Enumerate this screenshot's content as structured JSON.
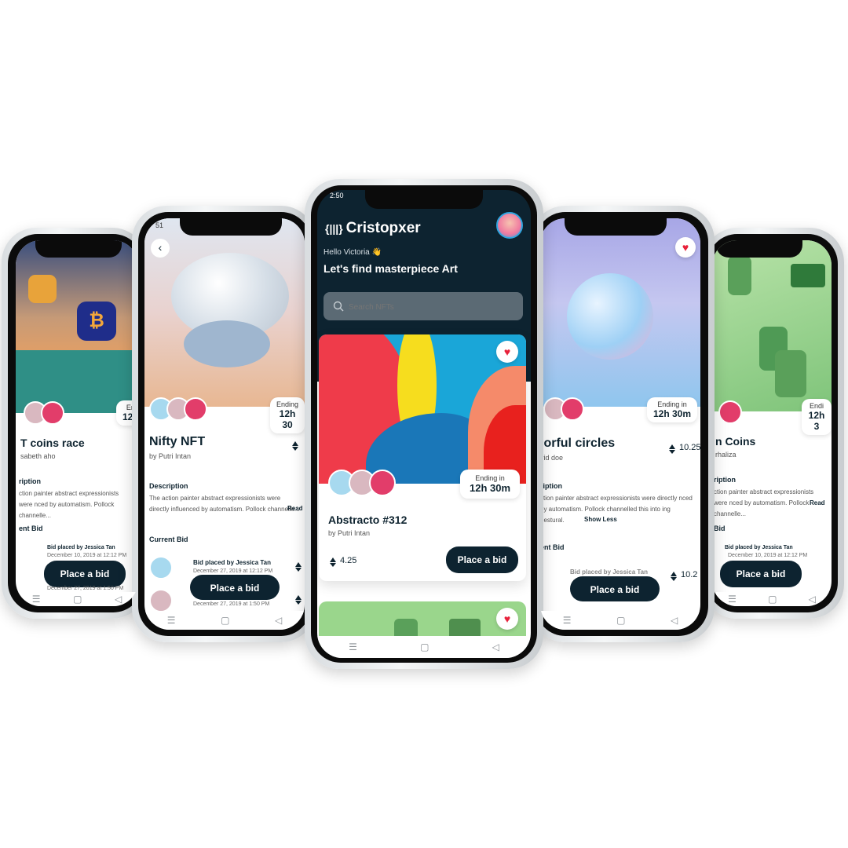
{
  "center": {
    "status_time": "2:50",
    "brand_icon": "{|||}",
    "brand_name": "Cristopxer",
    "greeting": "Hello Victoria 👋",
    "headline": "Let's find masterpiece Art",
    "search_placeholder": "Search NFTs",
    "card": {
      "ending_label": "Ending in",
      "ending_value": "12h 30m",
      "title": "Abstracto #312",
      "author": "by Putri Intan",
      "price": "4.25",
      "bid_label": "Place a bid"
    }
  },
  "left_near": {
    "status_time": "51",
    "ending_label": "Ending",
    "ending_value": "12h 30",
    "title": "Nifty NFT",
    "author": "by Putri Intan",
    "description_label": "Description",
    "description": "The action painter abstract expressionists were directly influenced by automatism. Pollock channelle...",
    "read_more": "Read",
    "current_bid_label": "Current Bid",
    "bid_by": "Bid placed by Jessica Tan",
    "bid_date_1": "December 27, 2019 at 12:12 PM",
    "bid_date_2": "December 27, 2019 at 1:50 PM",
    "bid_label": "Place a bid"
  },
  "left_far": {
    "ending_label": "En",
    "ending_value": "12h",
    "title": "T coins race",
    "author": "sabeth aho",
    "description_label": "ription",
    "description": "ction painter abstract expressionists were nced by automatism. Pollock channelle...",
    "current_bid_label": "ent Bid",
    "bid_by": "Bid placed by Jessica Tan",
    "bid_date_1": "December 10, 2019 at 12:12 PM",
    "bid_date_2": "December 27, 2019 at 1:50 PM",
    "bid_label": "Place a bid"
  },
  "right_near": {
    "ending_label": "Ending in",
    "ending_value": "12h 30m",
    "title": "lorful circles",
    "author": "vid doe",
    "price": "10.25",
    "description_label": "ription",
    "description": "ction painter abstract expressionists were directly nced by automatism. Pollock channelled this into ing gestural.",
    "show_less": "Show Less",
    "current_bid_label": "ent Bid",
    "bid_by": "Bid placed by Jessica Tan",
    "price_2": "10.2",
    "bid_label": "Place a bid"
  },
  "right_far": {
    "ending_label": "Endi",
    "ending_value": "12h 3",
    "title": "n Coins",
    "author": "rhaliza",
    "description_label": "ription",
    "description": "ction painter abstract expressionists were nced by automatism. Pollock channelle...",
    "read_more": "Read",
    "current_bid_label": "Bid",
    "bid_by": "Bid placed by Jessica Tan",
    "bid_date_1": "December 10, 2019 at 12:12 PM",
    "bid_label": "Place a bid"
  },
  "colors": {
    "dark": "#0d2330",
    "accent_heart": "#e8213a",
    "green_bg": "#9ad68c"
  },
  "icons": [
    "back-arrow-icon",
    "heart-icon",
    "search-icon",
    "eth-icon",
    "menu-icon",
    "home-icon",
    "back-icon"
  ]
}
